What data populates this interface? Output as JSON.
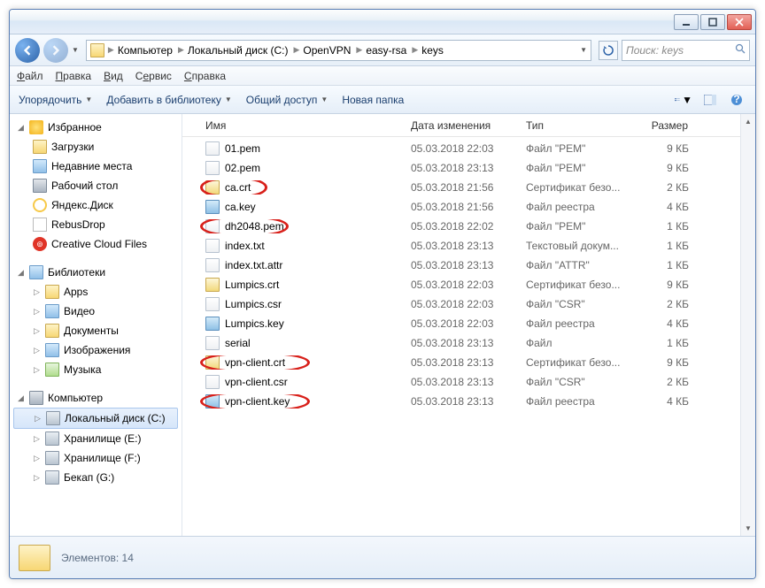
{
  "titlebar": {
    "min": "-",
    "max": "❐",
    "close": "✕"
  },
  "nav": {
    "crumbs": [
      "Компьютер",
      "Локальный диск (C:)",
      "OpenVPN",
      "easy-rsa",
      "keys"
    ],
    "search_placeholder": "Поиск: keys"
  },
  "menu": [
    "Файл",
    "Правка",
    "Вид",
    "Сервис",
    "Справка"
  ],
  "toolbar": {
    "organize": "Упорядочить",
    "addlib": "Добавить в библиотеку",
    "share": "Общий доступ",
    "newfolder": "Новая папка"
  },
  "tree": {
    "favorites": "Избранное",
    "fav_items": [
      "Загрузки",
      "Недавние места",
      "Рабочий стол",
      "Яндекс.Диск",
      "RebusDrop",
      "Creative Cloud Files"
    ],
    "libraries": "Библиотеки",
    "lib_items": [
      "Apps",
      "Видео",
      "Документы",
      "Изображения",
      "Музыка"
    ],
    "computer": "Компьютер",
    "comp_items": [
      "Локальный диск (C:)",
      "Хранилище (E:)",
      "Хранилище (F:)",
      "Бекап (G:)"
    ]
  },
  "columns": {
    "name": "Имя",
    "date": "Дата изменения",
    "type": "Тип",
    "size": "Размер"
  },
  "files": [
    {
      "name": "01.pem",
      "date": "05.03.2018 22:03",
      "type": "Файл \"PEM\"",
      "size": "9 КБ",
      "icon": "txt",
      "hl": false
    },
    {
      "name": "02.pem",
      "date": "05.03.2018 23:13",
      "type": "Файл \"PEM\"",
      "size": "9 КБ",
      "icon": "txt",
      "hl": false
    },
    {
      "name": "ca.crt",
      "date": "05.03.2018 21:56",
      "type": "Сертификат безо...",
      "size": "2 КБ",
      "icon": "cert",
      "hl": true
    },
    {
      "name": "ca.key",
      "date": "05.03.2018 21:56",
      "type": "Файл реестра",
      "size": "4 КБ",
      "icon": "key",
      "hl": false
    },
    {
      "name": "dh2048.pem",
      "date": "05.03.2018 22:02",
      "type": "Файл \"PEM\"",
      "size": "1 КБ",
      "icon": "txt",
      "hl": true
    },
    {
      "name": "index.txt",
      "date": "05.03.2018 23:13",
      "type": "Текстовый докум...",
      "size": "1 КБ",
      "icon": "txt",
      "hl": false
    },
    {
      "name": "index.txt.attr",
      "date": "05.03.2018 23:13",
      "type": "Файл \"ATTR\"",
      "size": "1 КБ",
      "icon": "txt",
      "hl": false
    },
    {
      "name": "Lumpics.crt",
      "date": "05.03.2018 22:03",
      "type": "Сертификат безо...",
      "size": "9 КБ",
      "icon": "cert",
      "hl": false
    },
    {
      "name": "Lumpics.csr",
      "date": "05.03.2018 22:03",
      "type": "Файл \"CSR\"",
      "size": "2 КБ",
      "icon": "txt",
      "hl": false
    },
    {
      "name": "Lumpics.key",
      "date": "05.03.2018 22:03",
      "type": "Файл реестра",
      "size": "4 КБ",
      "icon": "key",
      "hl": false
    },
    {
      "name": "serial",
      "date": "05.03.2018 23:13",
      "type": "Файл",
      "size": "1 КБ",
      "icon": "txt",
      "hl": false
    },
    {
      "name": "vpn-client.crt",
      "date": "05.03.2018 23:13",
      "type": "Сертификат безо...",
      "size": "9 КБ",
      "icon": "cert",
      "hl": true
    },
    {
      "name": "vpn-client.csr",
      "date": "05.03.2018 23:13",
      "type": "Файл \"CSR\"",
      "size": "2 КБ",
      "icon": "txt",
      "hl": false
    },
    {
      "name": "vpn-client.key",
      "date": "05.03.2018 23:13",
      "type": "Файл реестра",
      "size": "4 КБ",
      "icon": "key",
      "hl": true
    }
  ],
  "status": {
    "text": "Элементов: 14"
  }
}
